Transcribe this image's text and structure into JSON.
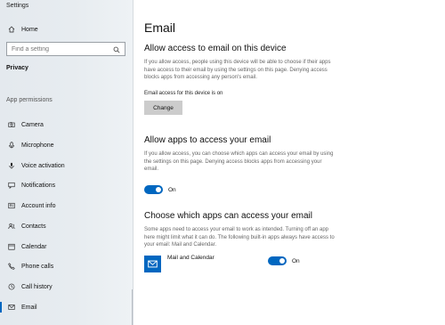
{
  "window": {
    "title": "Settings"
  },
  "sidebar": {
    "home_label": "Home",
    "search_placeholder": "Find a setting",
    "privacy_label": "Privacy",
    "section_label": "App permissions",
    "items": [
      {
        "label": "Camera",
        "icon": "camera-icon"
      },
      {
        "label": "Microphone",
        "icon": "microphone-icon"
      },
      {
        "label": "Voice activation",
        "icon": "voice-icon"
      },
      {
        "label": "Notifications",
        "icon": "notifications-icon"
      },
      {
        "label": "Account info",
        "icon": "account-icon"
      },
      {
        "label": "Contacts",
        "icon": "contacts-icon"
      },
      {
        "label": "Calendar",
        "icon": "calendar-icon"
      },
      {
        "label": "Phone calls",
        "icon": "phone-icon"
      },
      {
        "label": "Call history",
        "icon": "history-icon"
      },
      {
        "label": "Email",
        "icon": "mail-icon",
        "selected": true
      }
    ]
  },
  "main": {
    "title": "Email",
    "device_section": {
      "heading": "Allow access to email on this device",
      "description": "If you allow access, people using this device will be able to choose if their apps have access to their email by using the settings on this page. Denying access blocks apps from accessing any person's email.",
      "status": "Email access for this device is on",
      "button_label": "Change"
    },
    "apps_section": {
      "heading": "Allow apps to access your email",
      "description": "If you allow access, you can choose which apps can access your email by using the settings on this page. Denying access blocks apps from accessing your email.",
      "toggle_label": "On",
      "toggle_on": true
    },
    "choose_section": {
      "heading": "Choose which apps can access your email",
      "description": "Some apps need to access your email to work as intended. Turning off an app here might limit what it can do. The following built-in apps always have access to your email: Mail and Calendar.",
      "apps": [
        {
          "name": "Mail and Calendar",
          "toggle_label": "On",
          "toggle_on": true,
          "icon": "mail-app-icon"
        }
      ]
    }
  },
  "colors": {
    "accent": "#0067c0",
    "button_bg": "#cccccc",
    "sidebar_bg": "#e6ebef"
  }
}
